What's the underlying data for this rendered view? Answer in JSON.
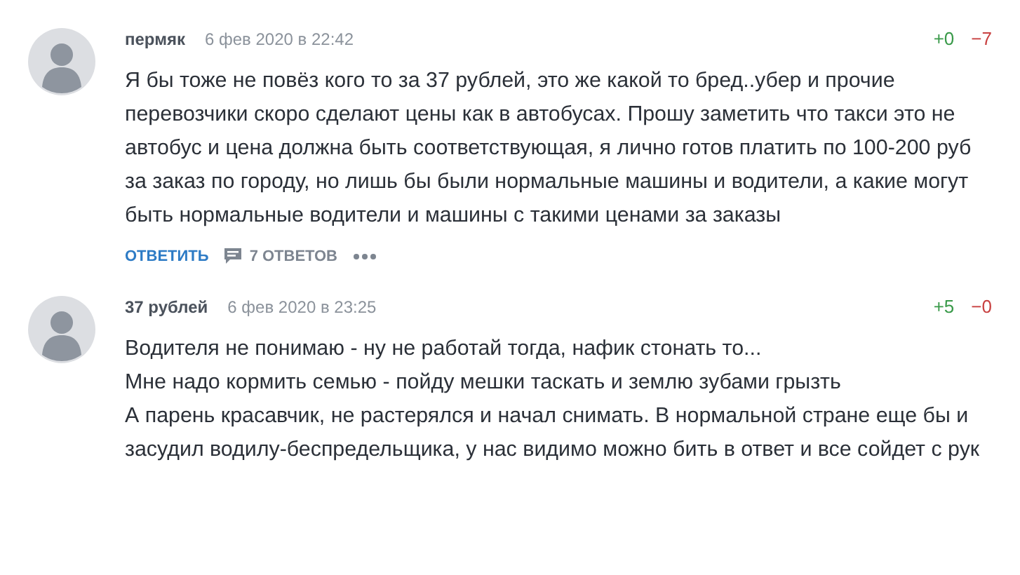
{
  "comments": [
    {
      "author": "пермяк",
      "date": "6 фев 2020 в 22:42",
      "votes_up": "+0",
      "votes_down": "−7",
      "paragraphs": [
        "Я бы тоже не повёз кого то за 37 рублей, это же какой то бред..убер и прочие перевозчики скоро сделают цены как в автобусах. Прошу заметить что такси это не автобус и цена должна быть соответствующая, я лично готов платить по 100-200 руб за заказ по городу, но лишь бы были нормальные машины и водители, а какие могут быть нормальные водители и машины с такими ценами за заказы"
      ],
      "actions": {
        "reply": "ОТВЕТИТЬ",
        "replies": "7 ОТВЕТОВ"
      }
    },
    {
      "author": "37 рублей",
      "date": "6 фев 2020 в 23:25",
      "votes_up": "+5",
      "votes_down": "−0",
      "paragraphs": [
        "Водителя не понимаю - ну не работай тогда, нафик стонать то...",
        "Мне надо кормить семью - пойду мешки таскать и землю зубами грызть",
        "А парень красавчик, не растерялся и начал снимать. В нормальной стране еще бы и засудил водилу-беспредельщика, у нас видимо можно бить в ответ и все сойдет с рук"
      ]
    }
  ]
}
